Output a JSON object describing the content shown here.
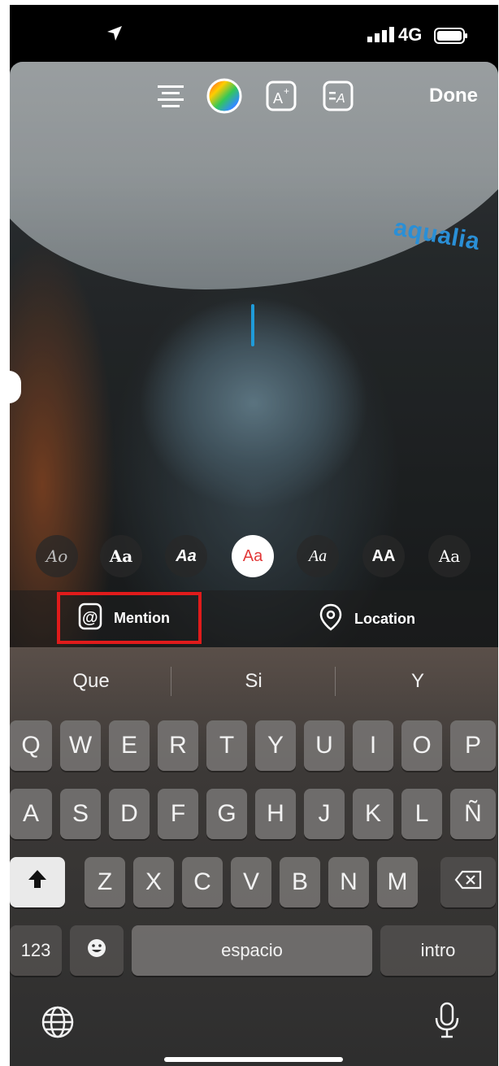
{
  "status_bar": {
    "network": "4G"
  },
  "photo": {
    "brand_text": "aqualia"
  },
  "toolbar": {
    "done_label": "Done",
    "icons": [
      "align-icon",
      "color-wheel-icon",
      "text-effects-icon",
      "text-animate-icon"
    ]
  },
  "font_styles": [
    "Ao",
    "Aa",
    "Aa",
    "Aa",
    "Aa",
    "AA",
    "Aa"
  ],
  "tags": {
    "mention_label": "Mention",
    "location_label": "Location"
  },
  "keyboard": {
    "suggestions": [
      "Que",
      "Si",
      "Y"
    ],
    "row1": [
      "Q",
      "W",
      "E",
      "R",
      "T",
      "Y",
      "U",
      "I",
      "O",
      "P"
    ],
    "row2": [
      "A",
      "S",
      "D",
      "F",
      "G",
      "H",
      "J",
      "K",
      "L",
      "Ñ"
    ],
    "row3": [
      "Z",
      "X",
      "C",
      "V",
      "B",
      "N",
      "M"
    ],
    "numbers_label": "123",
    "space_label": "espacio",
    "return_label": "intro"
  },
  "colors": {
    "accent_cursor": "#1f9bd9",
    "highlight_box": "#e01b1b"
  }
}
